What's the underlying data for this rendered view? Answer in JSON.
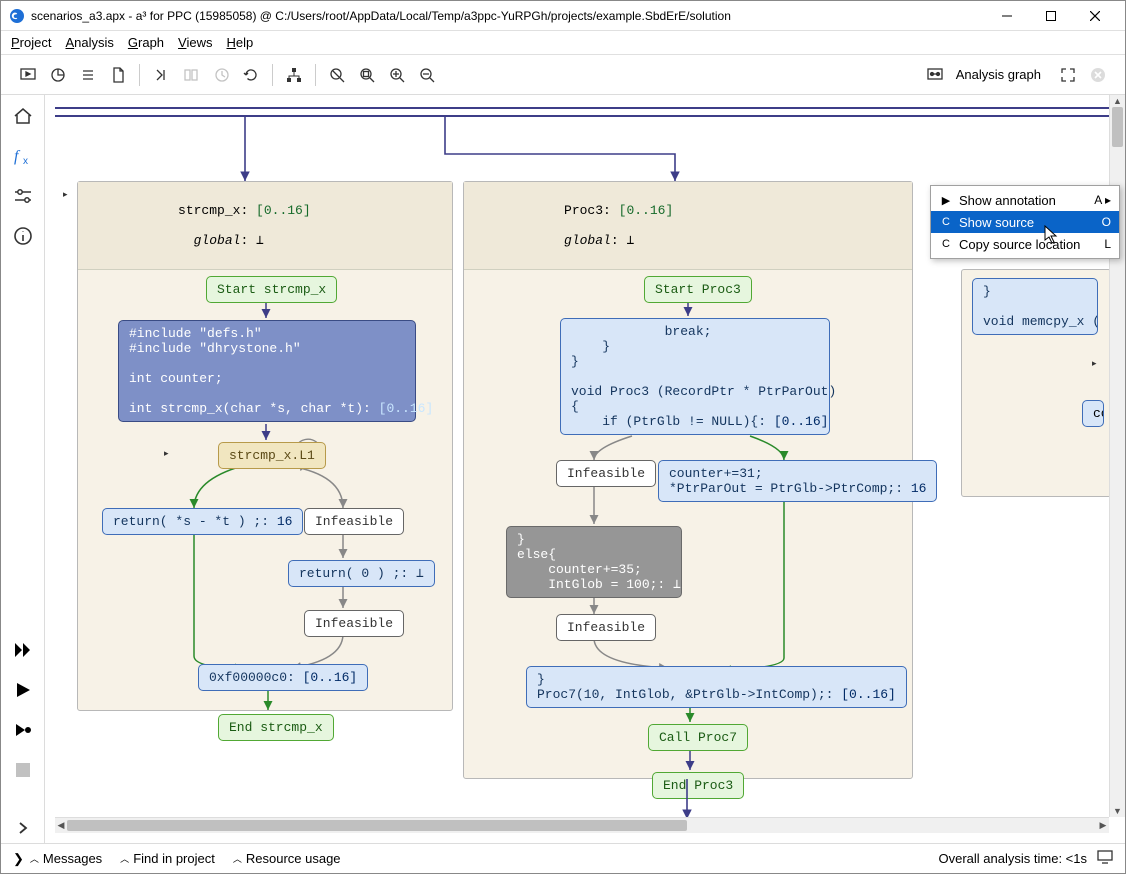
{
  "title": "scenarios_a3.apx - a³ for PPC (15985058) @ C:/Users/root/AppData/Local/Temp/a3ppc-YuRPGh/projects/example.SbdErE/solution",
  "menu": {
    "project": "Project",
    "analysis": "Analysis",
    "graph": "Graph",
    "views": "Views",
    "help": "Help"
  },
  "toolbar_right": "Analysis graph",
  "context_menu": {
    "annotation": {
      "label": "Show annotation",
      "key": "A ▸"
    },
    "source": {
      "label": "Show source",
      "key": "O"
    },
    "copy": {
      "label": "Copy source location",
      "key": "L"
    }
  },
  "statusbar": {
    "messages": "Messages",
    "find": "Find in project",
    "resource": "Resource usage",
    "time": "Overall analysis time: <1s"
  },
  "pane1": {
    "name": "strcmp_x",
    "range": "[0..16]",
    "sub": "global",
    "subval": "⊥",
    "start": "Start strcmp_x",
    "code": "#include \"defs.h\"\n#include \"dhrystone.h\"\n\nint counter;\n\nint strcmp_x(char *s, char *t): ",
    "code_range": "[0..16]",
    "loop": "strcmp_x.L1",
    "ret1a": "return( *s - *t ) ;: ",
    "ret1b": "16",
    "inf": "Infeasible",
    "ret2": "return( 0 ) ;: ⊥",
    "addr_a": "0xf00000c0: ",
    "addr_b": "[0..16]",
    "end": "End strcmp_x"
  },
  "pane2": {
    "name": "Proc3",
    "range": "[0..16]",
    "sub": "global",
    "subval": "⊥",
    "start": "Start Proc3",
    "code": "            break;\n    }\n}\n\nvoid Proc3 (RecordPtr * PtrParOut)\n{\n    if (PtrGlb != NULL){: ",
    "code_range": "[0..16]",
    "inf": "Infeasible",
    "ctr_a": "counter+=31;\n*PtrParOut = PtrGlb->PtrComp;: ",
    "ctr_b": "16",
    "else": "}\nelse{\n    counter+=35;\n    IntGlob = 100;: ⊥",
    "proc7_a": "}\nProc7(10, IntGlob, &PtrGlb->IntComp);: ",
    "proc7_b": "[0..16]",
    "call": "Call Proc7",
    "end": "End Proc3"
  },
  "pane3": {
    "code": "}\n\nvoid memcpy_x (cha",
    "cou": "cou"
  }
}
